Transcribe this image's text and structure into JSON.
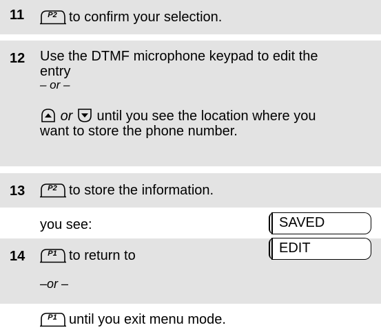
{
  "steps": {
    "s11": {
      "number": "11",
      "key": "P2",
      "text": "to confirm your selection."
    },
    "s12": {
      "number": "12",
      "line1": "Use the DTMF microphone keypad to edit the",
      "line2": "entry",
      "or": "– or –",
      "or_word": "or",
      "line4": "until you see the location where you",
      "line5": "want to store the phone number.",
      "up_icon": "up-arrow-key-icon",
      "down_icon": "down-arrow-key-icon"
    },
    "s13": {
      "number": "13",
      "key": "P2",
      "text": "to store the information.",
      "see_label": "you see:",
      "display": "SAVED"
    },
    "s14": {
      "number": "14",
      "key": "P1",
      "text": "to return to",
      "display": "EDIT",
      "or": "–or –",
      "key2": "P1",
      "text2": "until you exit menu mode."
    }
  },
  "colors": {
    "shading": "#e3e3e3",
    "text": "#000000"
  }
}
